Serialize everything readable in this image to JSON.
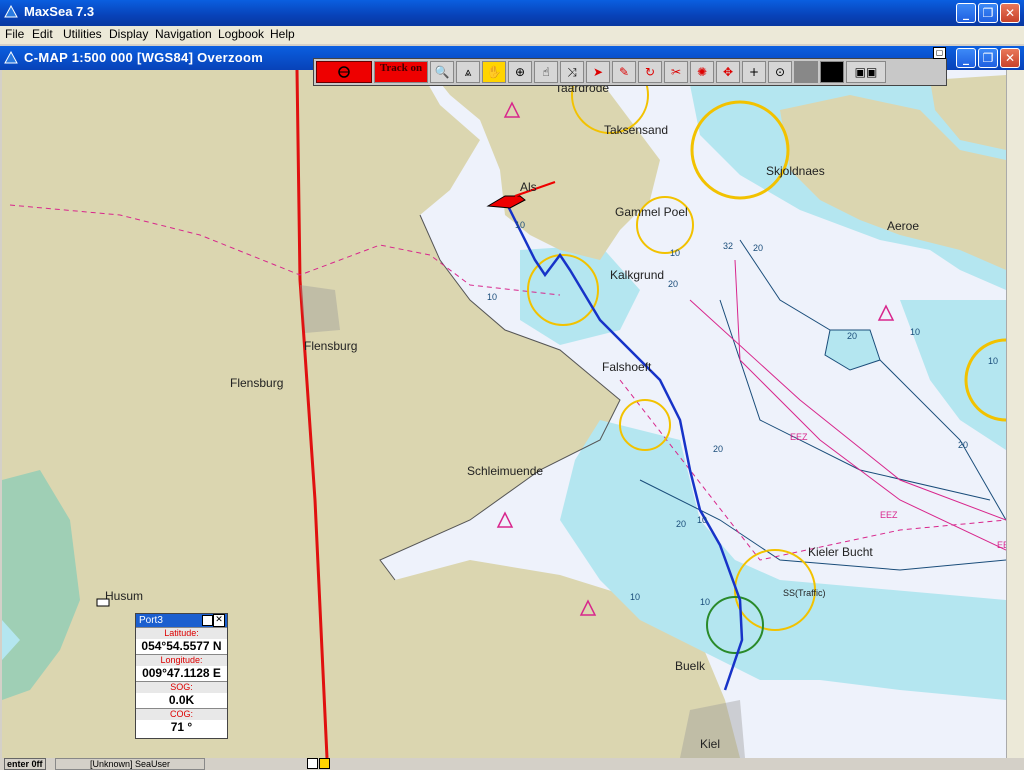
{
  "app": {
    "title": "MaxSea 7.3"
  },
  "menu": [
    "File",
    "Edit",
    "Utilities",
    "Display",
    "Navigation",
    "Logbook",
    "Help"
  ],
  "chart_window": {
    "caption": "C-MAP  1:500 000 [WGS84]    Overzoom"
  },
  "toolbar": {
    "track_label": "Track on"
  },
  "map": {
    "place_labels": [
      "Taksensand",
      "Skjoldnaes",
      "Aeroe",
      "Gammel Poel",
      "Kalkgrund",
      "Als",
      "Flensburg",
      "Flensburg",
      "Falshoeft",
      "Schleimuende",
      "Kieler Bucht",
      "Husum",
      "Buelk",
      "Kiel",
      "SS(Traffic)",
      "Taardrode"
    ],
    "depth_labels": [
      "32",
      "20",
      "10",
      "10",
      "20",
      "10",
      "10",
      "20",
      "20",
      "10",
      "20",
      "10",
      "EEZ",
      "EEZ",
      "EEZ",
      "10",
      "20",
      "10"
    ],
    "colors": {
      "land": "#dbd6b0",
      "shallow": "#b4e6f0",
      "deep": "#eef2fb",
      "track": "#1733c8",
      "border": "#e01010",
      "magenta": "#d8268c"
    }
  },
  "port_panel": {
    "title": "Port3",
    "rows": [
      {
        "label": "Latitude:",
        "value": "054°54.5577 N"
      },
      {
        "label": "Longitude:",
        "value": "009°47.1128 E"
      },
      {
        "label": "SOG:",
        "value": "0.0K"
      },
      {
        "label": "COG:",
        "value": "71 °"
      }
    ]
  },
  "status": {
    "left": "enter 0ff",
    "user": "[Unknown] SeaUser"
  }
}
